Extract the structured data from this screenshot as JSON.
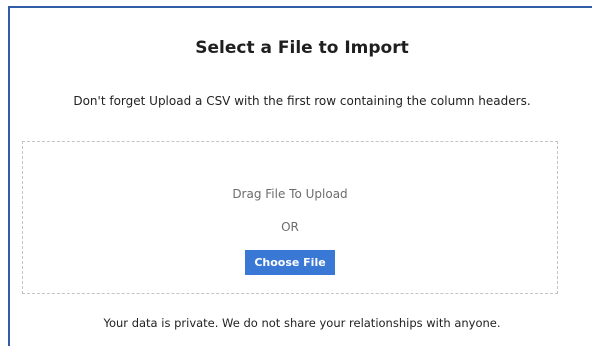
{
  "dialog": {
    "title": "Select a File to Import",
    "instructions": "Don't forget Upload a CSV with the first row containing the column headers."
  },
  "dropzone": {
    "drag_text": "Drag File To Upload",
    "or_text": "OR",
    "choose_button_label": "Choose File"
  },
  "footer": {
    "privacy_note": "Your data is private. We do not share your relationships with anyone."
  },
  "colors": {
    "frame_border": "#2f5da8",
    "button_background": "#3a78d6",
    "dropzone_border": "#c4c4c4"
  }
}
